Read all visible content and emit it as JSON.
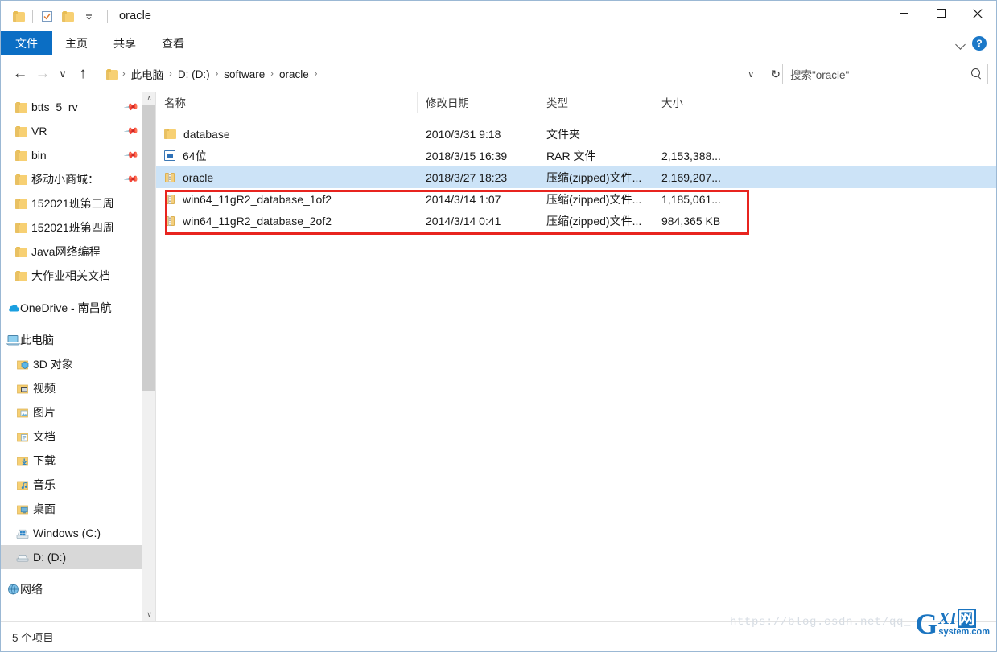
{
  "window": {
    "title": "oracle",
    "quick_access": [
      "folder-icon",
      "properties-icon",
      "new-folder-icon",
      "customize-dropdown-icon"
    ],
    "controls": {
      "minimize": "—",
      "maximize": "☐",
      "close": "✕"
    }
  },
  "ribbon": {
    "tabs": [
      {
        "label": "文件",
        "active": true
      },
      {
        "label": "主页",
        "active": false
      },
      {
        "label": "共享",
        "active": false
      },
      {
        "label": "查看",
        "active": false
      }
    ],
    "collapse_icon": "chevron-down-icon",
    "help_label": "?"
  },
  "navbar": {
    "back": "←",
    "forward": "→",
    "recent": "∨",
    "up": "↑",
    "breadcrumbs": [
      "此电脑",
      "D: (D:)",
      "software",
      "oracle"
    ],
    "breadcrumb_separator": "›",
    "address_dropdown": "∨",
    "refresh": "↻"
  },
  "search": {
    "placeholder": "搜索\"oracle\"",
    "value": "",
    "icon": "search-icon"
  },
  "sidebar": {
    "quick_access": [
      {
        "label": "btts_5_rv",
        "icon": "folder-icon",
        "pinned": true
      },
      {
        "label": "VR",
        "icon": "folder-icon",
        "pinned": true
      },
      {
        "label": "bin",
        "icon": "folder-icon",
        "pinned": true
      },
      {
        "label": "移动小商城：",
        "icon": "folder-icon",
        "pinned": true
      },
      {
        "label": "152021班第三周",
        "icon": "folder-icon",
        "pinned": false
      },
      {
        "label": "152021班第四周",
        "icon": "folder-icon",
        "pinned": false
      },
      {
        "label": "Java网络编程",
        "icon": "folder-icon",
        "pinned": false
      },
      {
        "label": "大作业相关文档",
        "icon": "folder-icon",
        "pinned": false
      }
    ],
    "onedrive": {
      "label": "OneDrive - 南昌航",
      "icon": "onedrive-cloud-icon"
    },
    "this_pc": {
      "label": "此电脑",
      "icon": "this-pc-icon"
    },
    "pc_children": [
      {
        "label": "3D 对象",
        "icon": "3d-objects-icon",
        "selected": false
      },
      {
        "label": "视频",
        "icon": "videos-icon",
        "selected": false
      },
      {
        "label": "图片",
        "icon": "pictures-icon",
        "selected": false
      },
      {
        "label": "文档",
        "icon": "documents-icon",
        "selected": false
      },
      {
        "label": "下载",
        "icon": "downloads-icon",
        "selected": false
      },
      {
        "label": "音乐",
        "icon": "music-icon",
        "selected": false
      },
      {
        "label": "桌面",
        "icon": "desktop-icon",
        "selected": false
      },
      {
        "label": "Windows (C:)",
        "icon": "windows-drive-icon",
        "selected": false
      },
      {
        "label": "D: (D:)",
        "icon": "drive-icon",
        "selected": true
      }
    ],
    "network": {
      "label": "网络",
      "icon": "network-icon"
    },
    "scroll_up": "∧",
    "scroll_down": "∨"
  },
  "filelist": {
    "columns": [
      {
        "key": "name",
        "label": "名称"
      },
      {
        "key": "date",
        "label": "修改日期"
      },
      {
        "key": "type",
        "label": "类型"
      },
      {
        "key": "size",
        "label": "大小"
      }
    ],
    "sort_indicator": "∧",
    "rows": [
      {
        "name": "database",
        "date": "2010/3/31 9:18",
        "type": "文件夹",
        "size": "",
        "icon": "folder-icon",
        "selected": false
      },
      {
        "name": "64位",
        "date": "2018/3/15 16:39",
        "type": "RAR 文件",
        "size": "2,153,388...",
        "icon": "rar-file-icon",
        "selected": false
      },
      {
        "name": "oracle",
        "date": "2018/3/27 18:23",
        "type": "压缩(zipped)文件...",
        "size": "2,169,207...",
        "icon": "zip-folder-icon",
        "selected": true
      },
      {
        "name": "win64_11gR2_database_1of2",
        "date": "2014/3/14 1:07",
        "type": "压缩(zipped)文件...",
        "size": "1,185,061...",
        "icon": "zip-folder-icon",
        "selected": false
      },
      {
        "name": "win64_11gR2_database_2of2",
        "date": "2014/3/14 0:41",
        "type": "压缩(zipped)文件...",
        "size": "984,365 KB",
        "icon": "zip-folder-icon",
        "selected": false
      }
    ]
  },
  "annotation": {
    "color": "#e8241f",
    "highlights_rows": [
      3,
      4
    ]
  },
  "statusbar": {
    "item_count": "5 个项目"
  },
  "watermarks": {
    "url": "https://blog.csdn.net/qq_",
    "logo_g": "G",
    "logo_xi": "XI",
    "logo_box": "网",
    "logo_domain": "system.com"
  }
}
